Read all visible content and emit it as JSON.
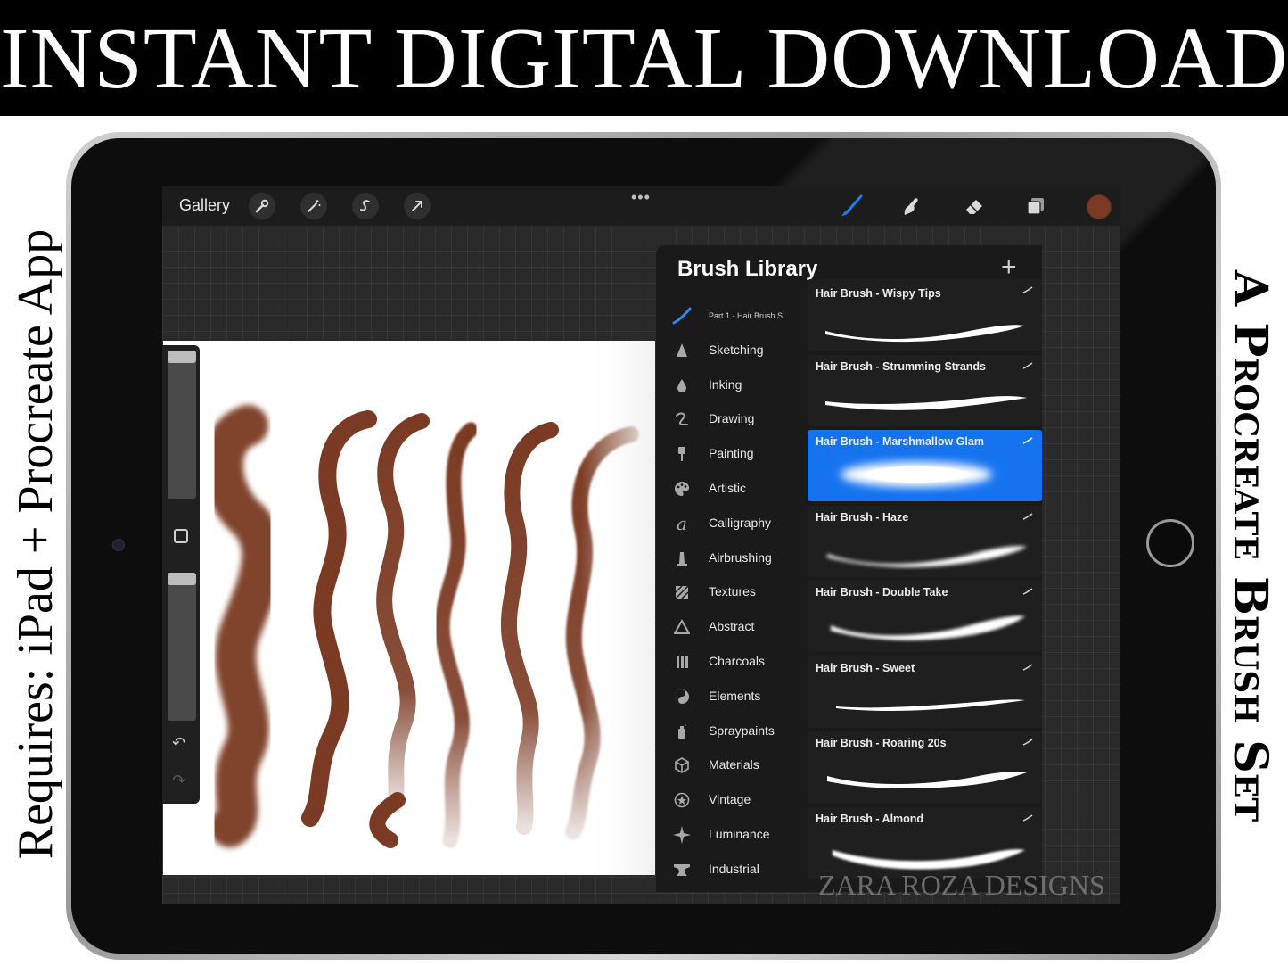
{
  "banner": {
    "title": "INSTANT DIGITAL DOWNLOAD"
  },
  "side_text": {
    "left": "Requires: iPad + Procreate App",
    "right": "A Procreate Brush Set"
  },
  "topbar": {
    "gallery_label": "Gallery",
    "more_label": "•••",
    "current_color": "#7a3a23"
  },
  "brush_library": {
    "title": "Brush Library",
    "add_label": "+",
    "categories": [
      {
        "label": "Part 1 - Hair Brush S...",
        "icon": "brush-stroke-icon"
      },
      {
        "label": "Sketching",
        "icon": "pencil-tip-icon"
      },
      {
        "label": "Inking",
        "icon": "ink-drop-icon"
      },
      {
        "label": "Drawing",
        "icon": "squiggle-icon"
      },
      {
        "label": "Painting",
        "icon": "paint-brush-icon"
      },
      {
        "label": "Artistic",
        "icon": "palette-icon"
      },
      {
        "label": "Calligraphy",
        "icon": "calligraphy-icon"
      },
      {
        "label": "Airbrushing",
        "icon": "airbrush-icon"
      },
      {
        "label": "Textures",
        "icon": "texture-icon"
      },
      {
        "label": "Abstract",
        "icon": "triangle-icon"
      },
      {
        "label": "Charcoals",
        "icon": "charcoal-icon"
      },
      {
        "label": "Elements",
        "icon": "yin-yang-icon"
      },
      {
        "label": "Spraypaints",
        "icon": "spray-can-icon"
      },
      {
        "label": "Materials",
        "icon": "cube-icon"
      },
      {
        "label": "Vintage",
        "icon": "star-circle-icon"
      },
      {
        "label": "Luminance",
        "icon": "sparkle-icon"
      },
      {
        "label": "Industrial",
        "icon": "anvil-icon"
      }
    ],
    "brushes": [
      {
        "name": "Hair Brush - Wispy Tips",
        "selected": false
      },
      {
        "name": "Hair Brush - Strumming Strands",
        "selected": false
      },
      {
        "name": "Hair Brush - Marshmallow Glam",
        "selected": true
      },
      {
        "name": "Hair Brush - Haze",
        "selected": false
      },
      {
        "name": "Hair Brush - Double Take",
        "selected": false
      },
      {
        "name": "Hair Brush - Sweet",
        "selected": false
      },
      {
        "name": "Hair Brush - Roaring 20s",
        "selected": false
      },
      {
        "name": "Hair Brush - Almond",
        "selected": false
      }
    ]
  },
  "watermark": "ZARA ROZA DESIGNS",
  "colors": {
    "accent": "#1673f0",
    "stroke": "#7a3a23",
    "panel": "#1a1a1a"
  }
}
